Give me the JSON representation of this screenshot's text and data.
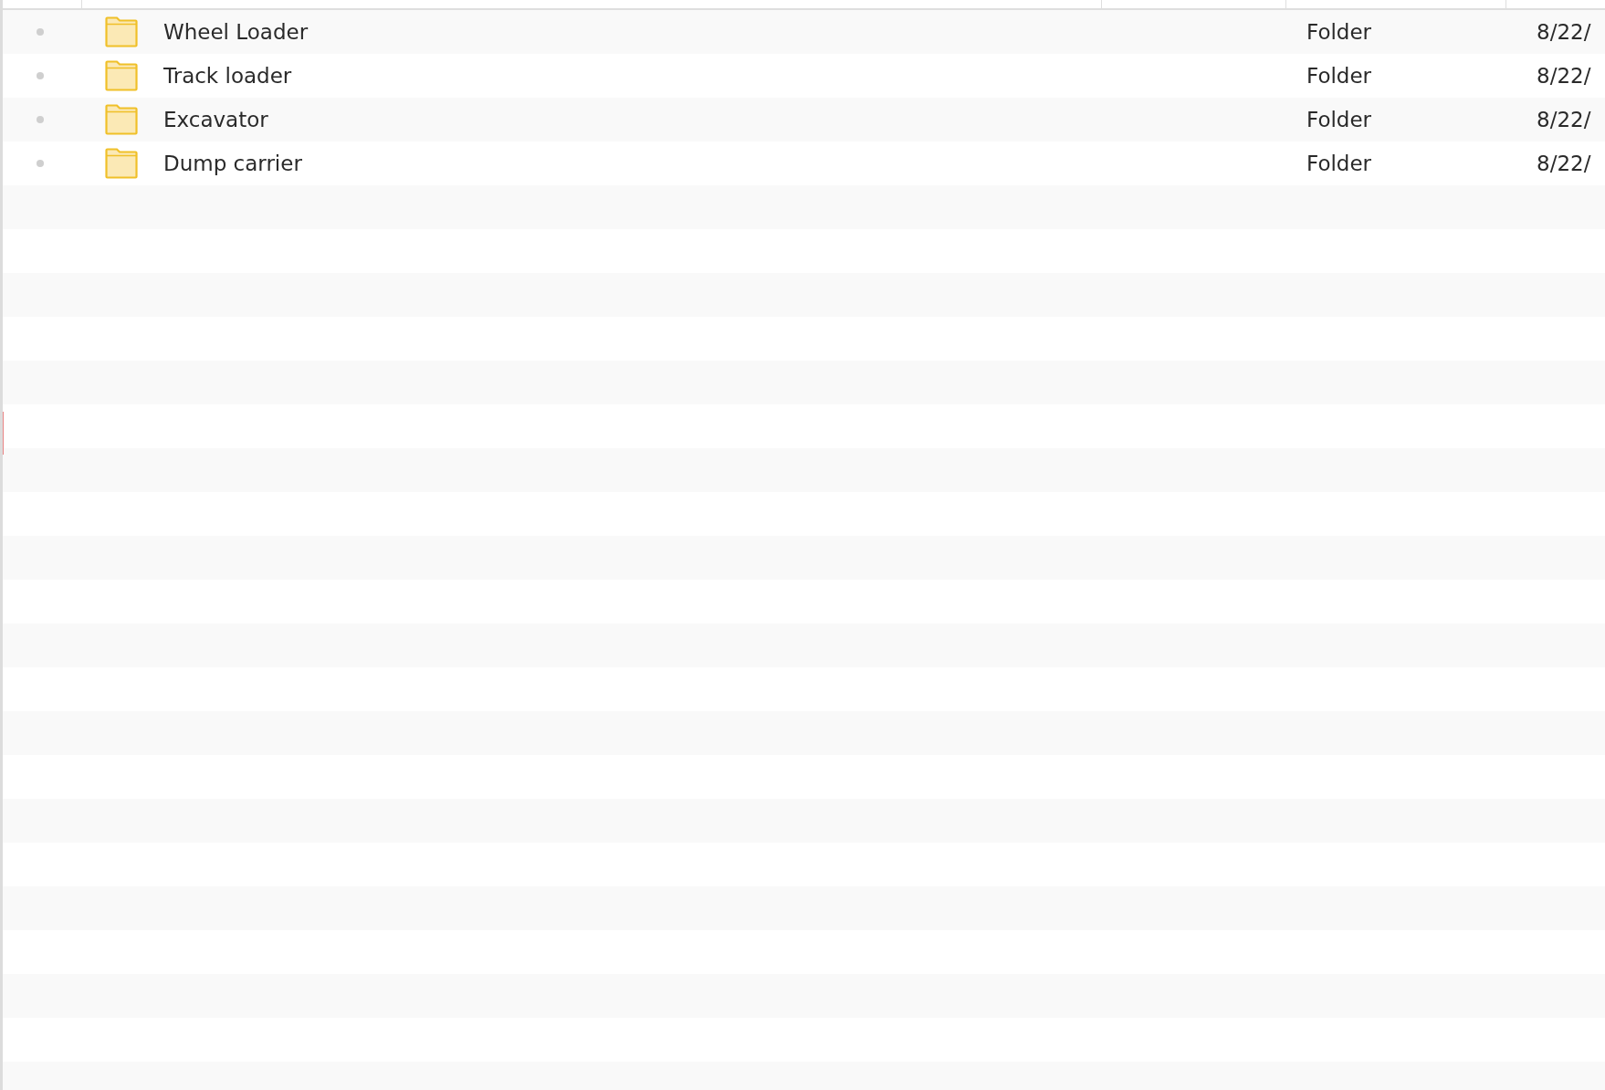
{
  "table": {
    "rows": [
      {
        "name": "Wheel Loader",
        "type": "Folder",
        "date": "8/22/"
      },
      {
        "name": "Track loader",
        "type": "Folder",
        "date": "8/22/"
      },
      {
        "name": "Excavator",
        "type": "Folder",
        "date": "8/22/"
      },
      {
        "name": "Dump carrier",
        "type": "Folder",
        "date": "8/22/"
      }
    ]
  }
}
